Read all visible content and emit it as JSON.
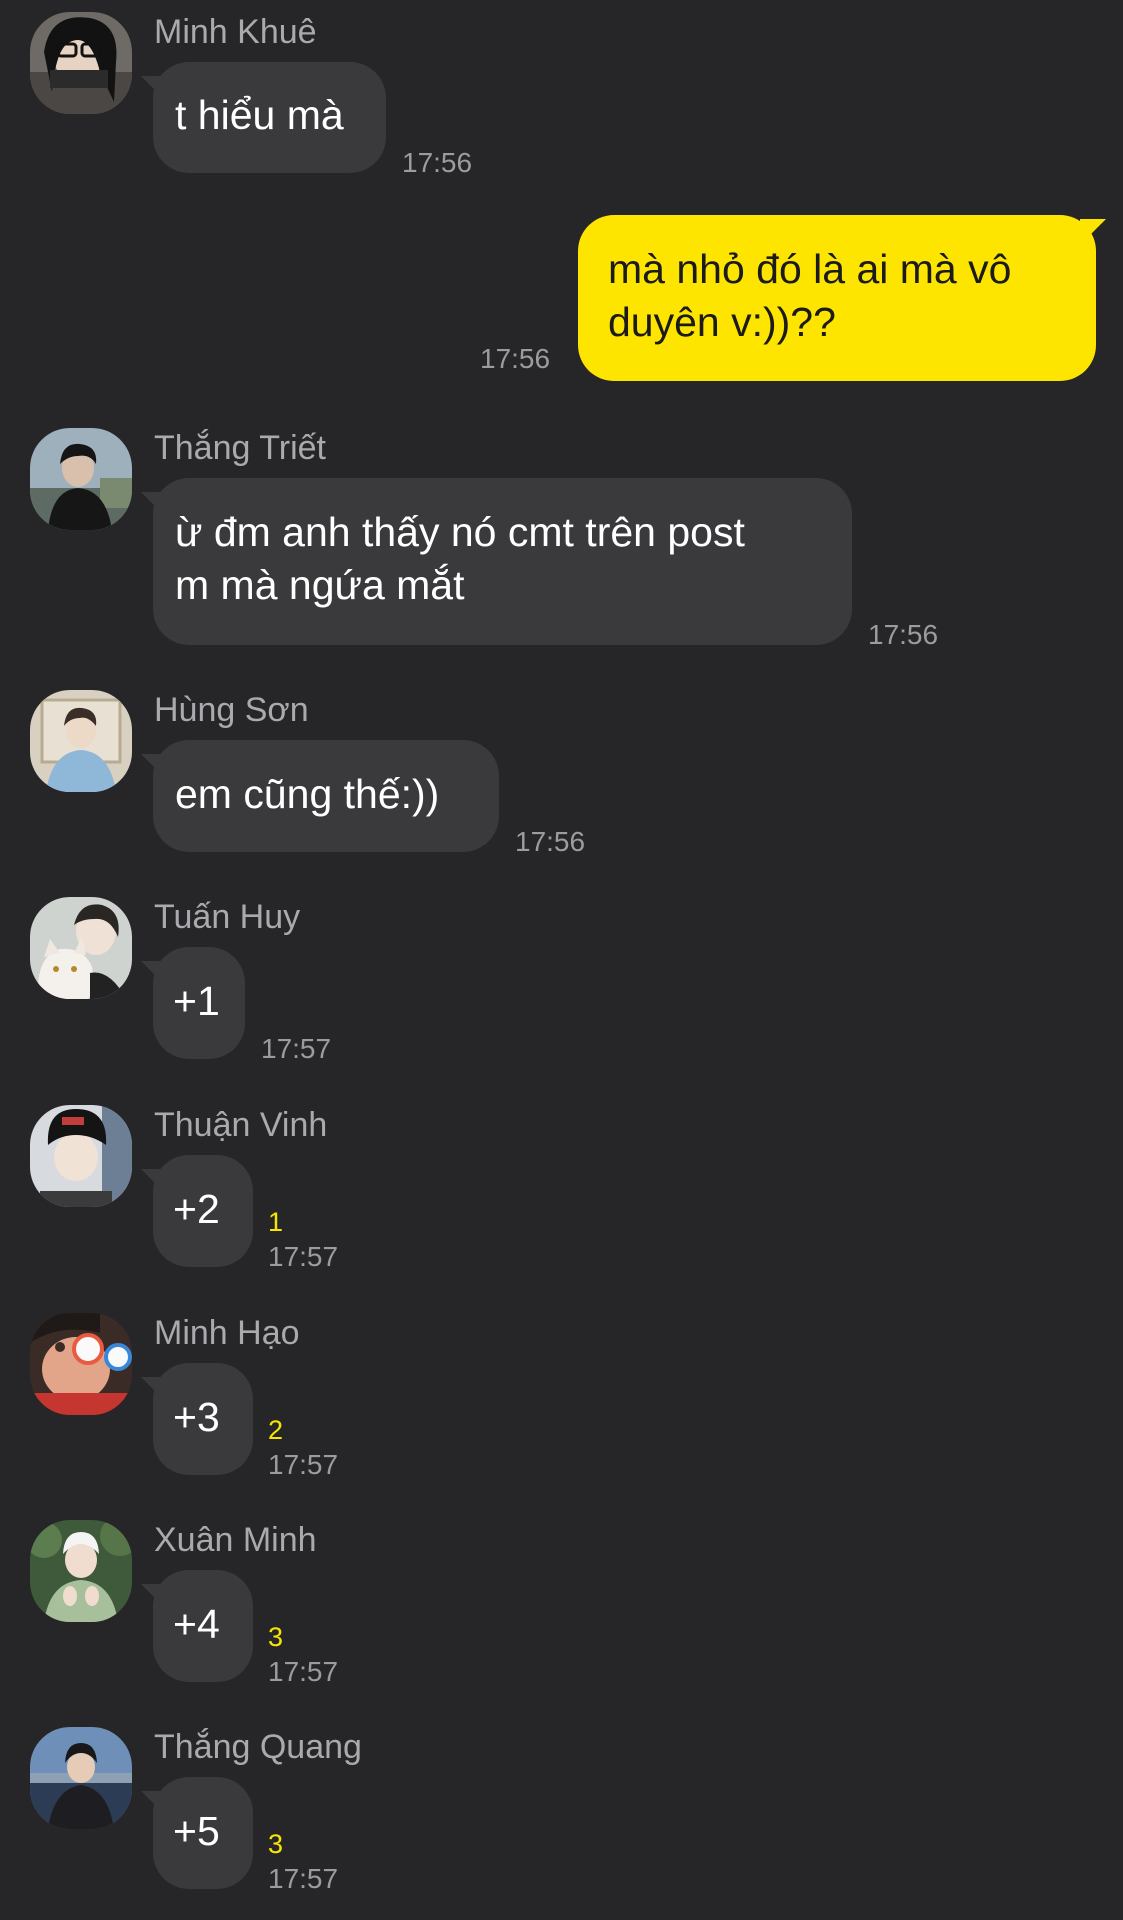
{
  "messages": [
    {
      "sender": "Minh Khuê",
      "text": "t hiểu mà",
      "time": "17:56",
      "unread": "",
      "avatar": "avatar-minh-khue"
    },
    {
      "sender": "",
      "text": "mà nhỏ đó là ai mà vô duyên v:))??",
      "lines": [
        "mà nhỏ đó là ai mà vô",
        "duyên v:))??"
      ],
      "time": "17:56",
      "mine": true
    },
    {
      "sender": "Thắng Triết",
      "lines": [
        "ừ đm anh thấy nó cmt trên post",
        "m mà ngứa mắt"
      ],
      "time": "17:56",
      "unread": ""
    },
    {
      "sender": "Hùng Sơn",
      "text": "em cũng thế:))",
      "time": "17:56",
      "unread": ""
    },
    {
      "sender": "Tuấn Huy",
      "text": "+1",
      "time": "17:57",
      "unread": ""
    },
    {
      "sender": "Thuận Vinh",
      "text": "+2",
      "time": "17:57",
      "unread": "1"
    },
    {
      "sender": "Minh Hạo",
      "text": "+3",
      "time": "17:57",
      "unread": "2"
    },
    {
      "sender": "Xuân Minh",
      "text": "+4",
      "time": "17:57",
      "unread": "3"
    },
    {
      "sender": "Thắng Quang",
      "text": "+5",
      "time": "17:57",
      "unread": "3"
    }
  ],
  "colors": {
    "background": "#262628",
    "incoming_bubble": "#3a3a3c",
    "outgoing_bubble": "#fee500",
    "unread_count": "#f7e600"
  }
}
